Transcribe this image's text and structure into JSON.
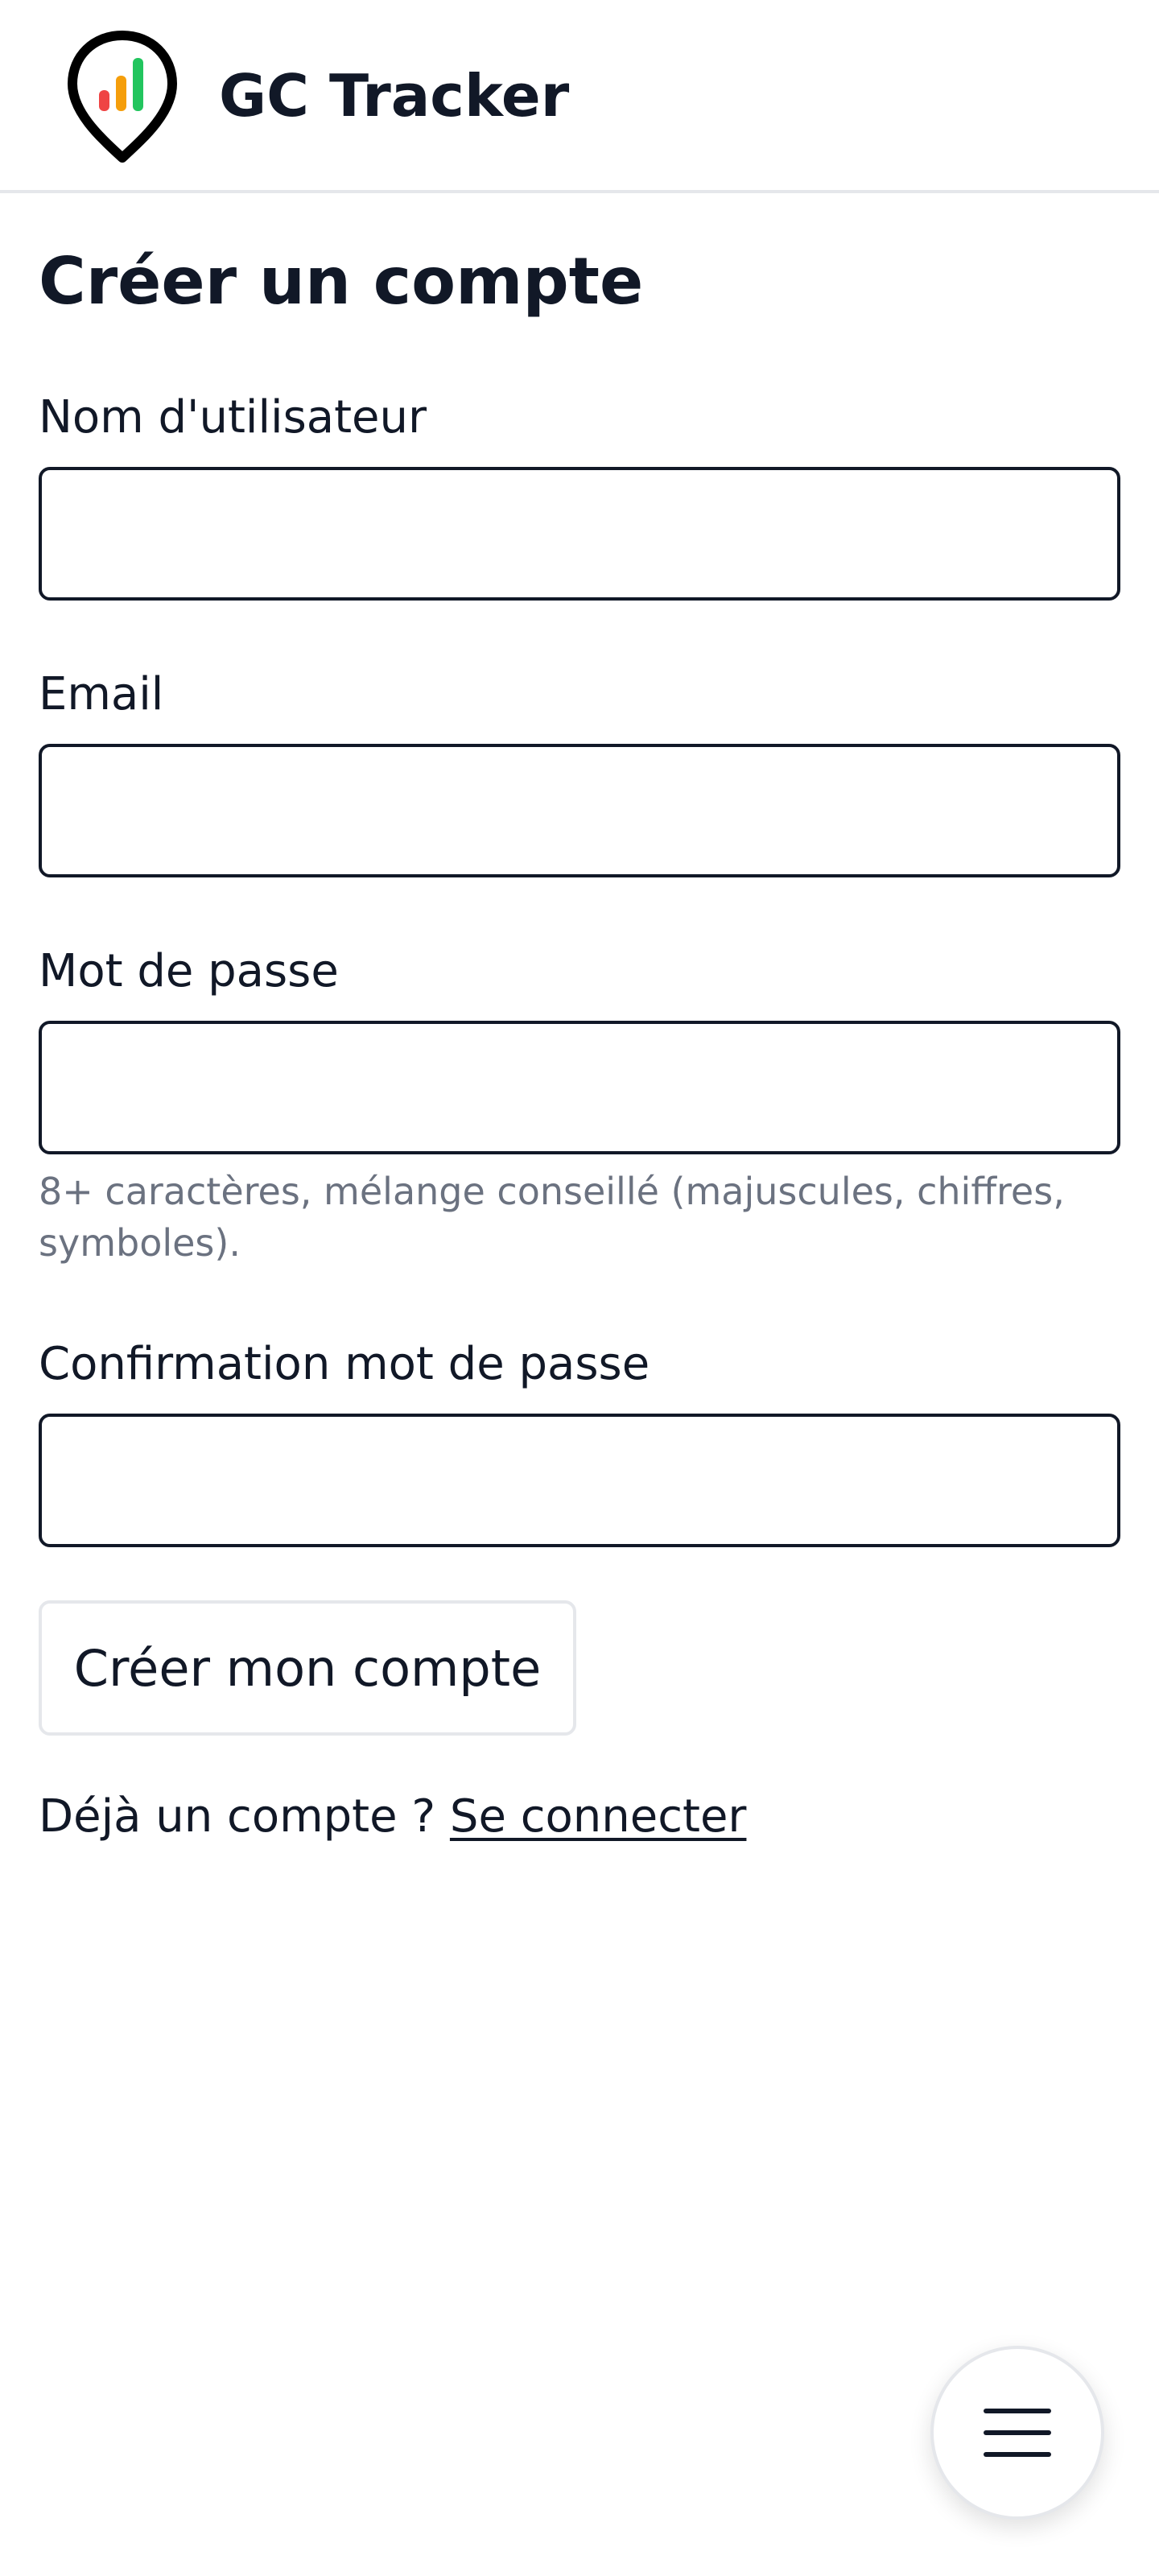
{
  "app": {
    "title": "GC Tracker"
  },
  "logo": {
    "icon": "map-pin-bar-chart-icon",
    "colors": [
      "#ef4444",
      "#f59e0b",
      "#22c55e"
    ]
  },
  "page": {
    "title": "Créer un compte"
  },
  "form": {
    "username": {
      "label": "Nom d'utilisateur",
      "value": "",
      "placeholder": ""
    },
    "email": {
      "label": "Email",
      "value": "",
      "placeholder": ""
    },
    "password": {
      "label": "Mot de passe",
      "value": "",
      "placeholder": "",
      "hint": "8+ caractères, mélange conseillé (majuscules, chiffres, symboles)."
    },
    "password_confirm": {
      "label": "Confirmation mot de passe",
      "value": "",
      "placeholder": ""
    },
    "submit_label": "Créer mon compte"
  },
  "login": {
    "prompt": "Déjà un compte ? ",
    "link_label": "Se connecter"
  },
  "menu": {
    "icon": "hamburger-menu-icon"
  }
}
